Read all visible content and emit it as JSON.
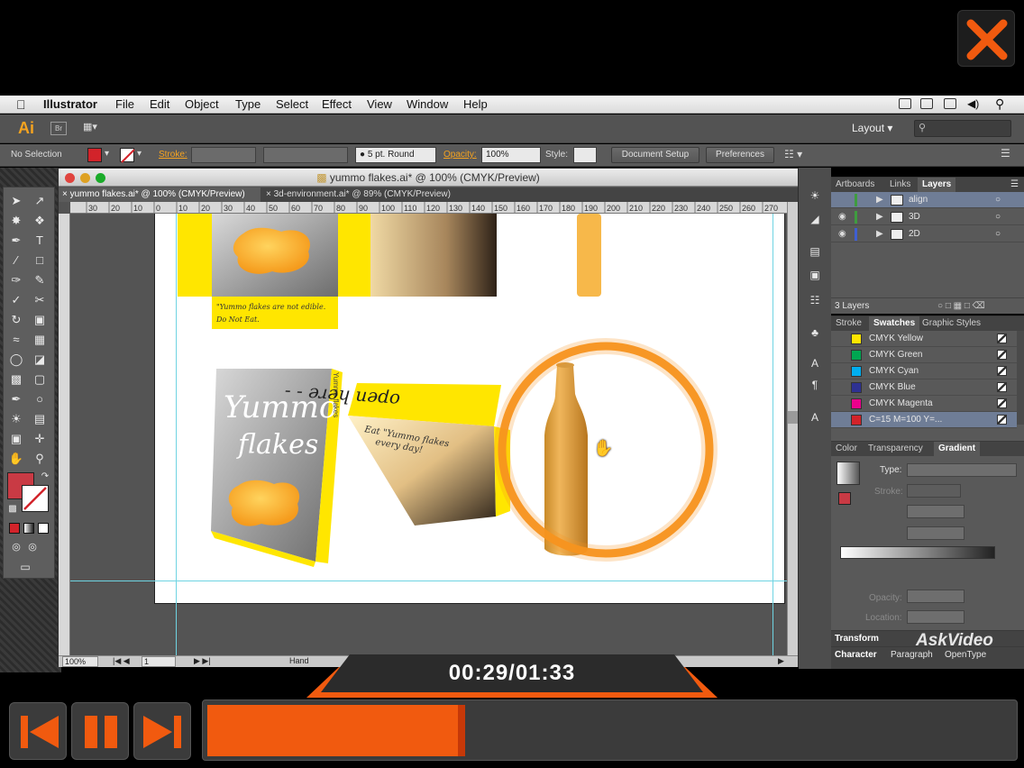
{
  "menubar": {
    "app_name": "Illustrator",
    "items": [
      "File",
      "Edit",
      "Object",
      "Type",
      "Select",
      "Effect",
      "View",
      "Window",
      "Help"
    ]
  },
  "appbar": {
    "logo": "Ai",
    "bridge": "Br",
    "layout_label": "Layout",
    "search_placeholder": ""
  },
  "control_bar": {
    "selection": "No Selection",
    "stroke_label": "Stroke:",
    "brush": "5 pt. Round",
    "opacity_label": "Opacity:",
    "opacity_value": "100%",
    "style_label": "Style:",
    "document_setup": "Document Setup",
    "preferences": "Preferences"
  },
  "document": {
    "window_title": "yummo flakes.ai* @ 100% (CMYK/Preview)",
    "tabs": [
      {
        "label": "yummo flakes.ai* @ 100% (CMYK/Preview)"
      },
      {
        "label": "3d-environment.ai* @ 89% (CMYK/Preview)"
      }
    ],
    "ruler_ticks": [
      "30",
      "20",
      "10",
      "0",
      "10",
      "20",
      "30",
      "40",
      "50",
      "60",
      "70",
      "80",
      "90",
      "100",
      "110",
      "120",
      "130",
      "140",
      "150",
      "160",
      "170",
      "180",
      "190",
      "200",
      "210",
      "220",
      "230",
      "240",
      "250",
      "260",
      "270"
    ],
    "zoom": "100%",
    "artboard_num": "1",
    "status": "Hand"
  },
  "artwork": {
    "front_text_1": "Yummo",
    "front_text_2": "flakes",
    "side_text": "Yummo flakes",
    "label_1": "\"Yummo flakes are not edible.",
    "label_2": "Do Not Eat.",
    "lid_text": "open here - -",
    "top_text_1": "Eat \"Yummo flakes",
    "top_text_2": "every day!"
  },
  "panels": {
    "layers": {
      "tabs": [
        "Artboards",
        "Links",
        "Layers"
      ],
      "active_tab": "Layers",
      "rows": [
        {
          "name": "align",
          "color": "#3f9c3f"
        },
        {
          "name": "3D",
          "color": "#3f9c3f"
        },
        {
          "name": "2D",
          "color": "#3f5fd1"
        }
      ],
      "footer": "3 Layers"
    },
    "swatches": {
      "tabs": [
        "Stroke",
        "Swatches",
        "Graphic Styles"
      ],
      "active_tab": "Swatches",
      "rows": [
        {
          "name": "CMYK Yellow",
          "color": "#ffe600"
        },
        {
          "name": "CMYK Green",
          "color": "#00a651"
        },
        {
          "name": "CMYK Cyan",
          "color": "#00aeef"
        },
        {
          "name": "CMYK Blue",
          "color": "#2e3192"
        },
        {
          "name": "CMYK Magenta",
          "color": "#ec008c"
        },
        {
          "name": "C=15 M=100 Y=...",
          "color": "#d2232a"
        }
      ]
    },
    "gradient": {
      "tabs": [
        "Color",
        "Transparency",
        "Gradient"
      ],
      "active_tab": "Gradient",
      "type_label": "Type:",
      "stroke_label": "Stroke:",
      "opacity_label": "Opacity:",
      "location_label": "Location:"
    },
    "transform": {
      "label": "Transform"
    },
    "character": {
      "tabs": [
        "Character",
        "Paragraph",
        "OpenType"
      ]
    }
  },
  "watermark": "AskVideo",
  "player": {
    "time": "00:29/01:33",
    "progress": 0.32,
    "accent": "#f15a0f"
  },
  "colors": {
    "accent_orange": "#f15a0f",
    "ai_orange": "#f5a320",
    "fill_red": "#c93a44"
  }
}
